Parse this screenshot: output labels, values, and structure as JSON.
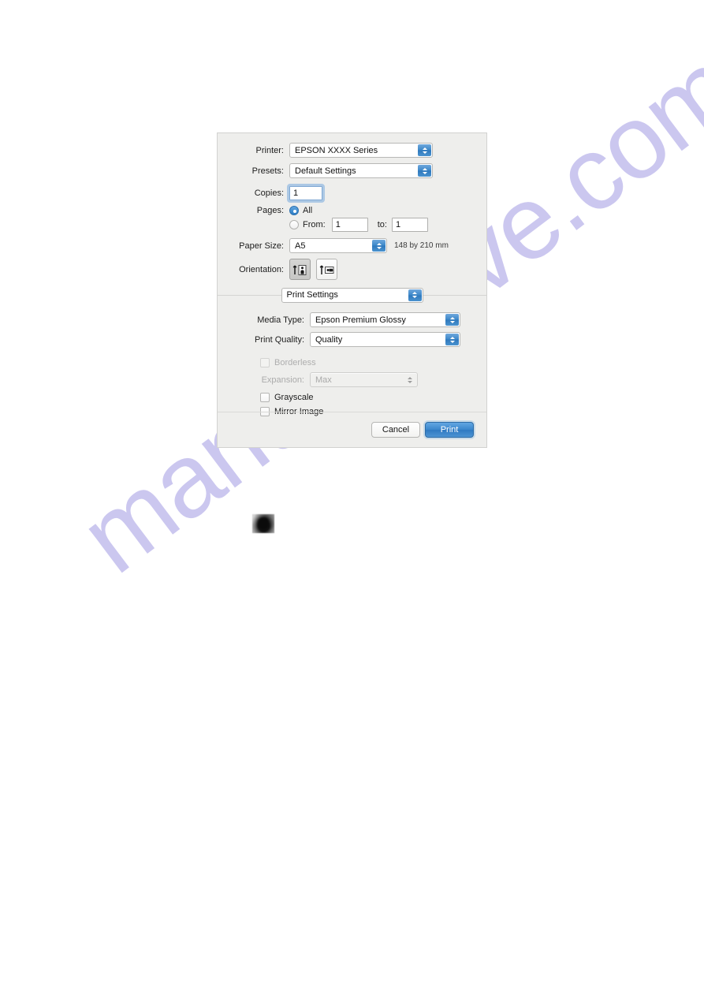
{
  "page": {
    "background_color": "#ffffff",
    "watermark_text": "manualshive.com",
    "watermark_color": "#c9c5ef"
  },
  "dialog": {
    "name": "macOS Print dialog",
    "printer": {
      "label": "Printer:",
      "value": "EPSON XXXX Series"
    },
    "presets": {
      "label": "Presets:",
      "value": "Default Settings"
    },
    "copies": {
      "label": "Copies:",
      "value": "1"
    },
    "pages": {
      "label": "Pages:",
      "all_label": "All",
      "all_selected": true,
      "from_label": "From:",
      "from_value": "1",
      "to_label": "to:",
      "to_value": "1"
    },
    "paper_size": {
      "label": "Paper Size:",
      "value": "A5",
      "dimensions": "148 by 210 mm"
    },
    "orientation": {
      "label": "Orientation:",
      "portrait_icon": "portrait-orientation-icon",
      "landscape_icon": "landscape-orientation-icon",
      "selected": "portrait"
    },
    "pane": {
      "value": "Print Settings"
    },
    "print_settings": {
      "media_type": {
        "label": "Media Type:",
        "value": "Epson Premium Glossy"
      },
      "print_quality": {
        "label": "Print Quality:",
        "value": "Quality"
      },
      "borderless": {
        "label": "Borderless",
        "checked": false,
        "enabled": false
      },
      "expansion": {
        "label": "Expansion:",
        "value": "Max",
        "enabled": false
      },
      "grayscale": {
        "label": "Grayscale",
        "checked": false
      },
      "mirror_image": {
        "label": "Mirror Image",
        "checked": false
      }
    },
    "buttons": {
      "cancel": "Cancel",
      "print": "Print"
    }
  },
  "apple_logo": {
    "name": "apple-logo-thumbnail"
  }
}
